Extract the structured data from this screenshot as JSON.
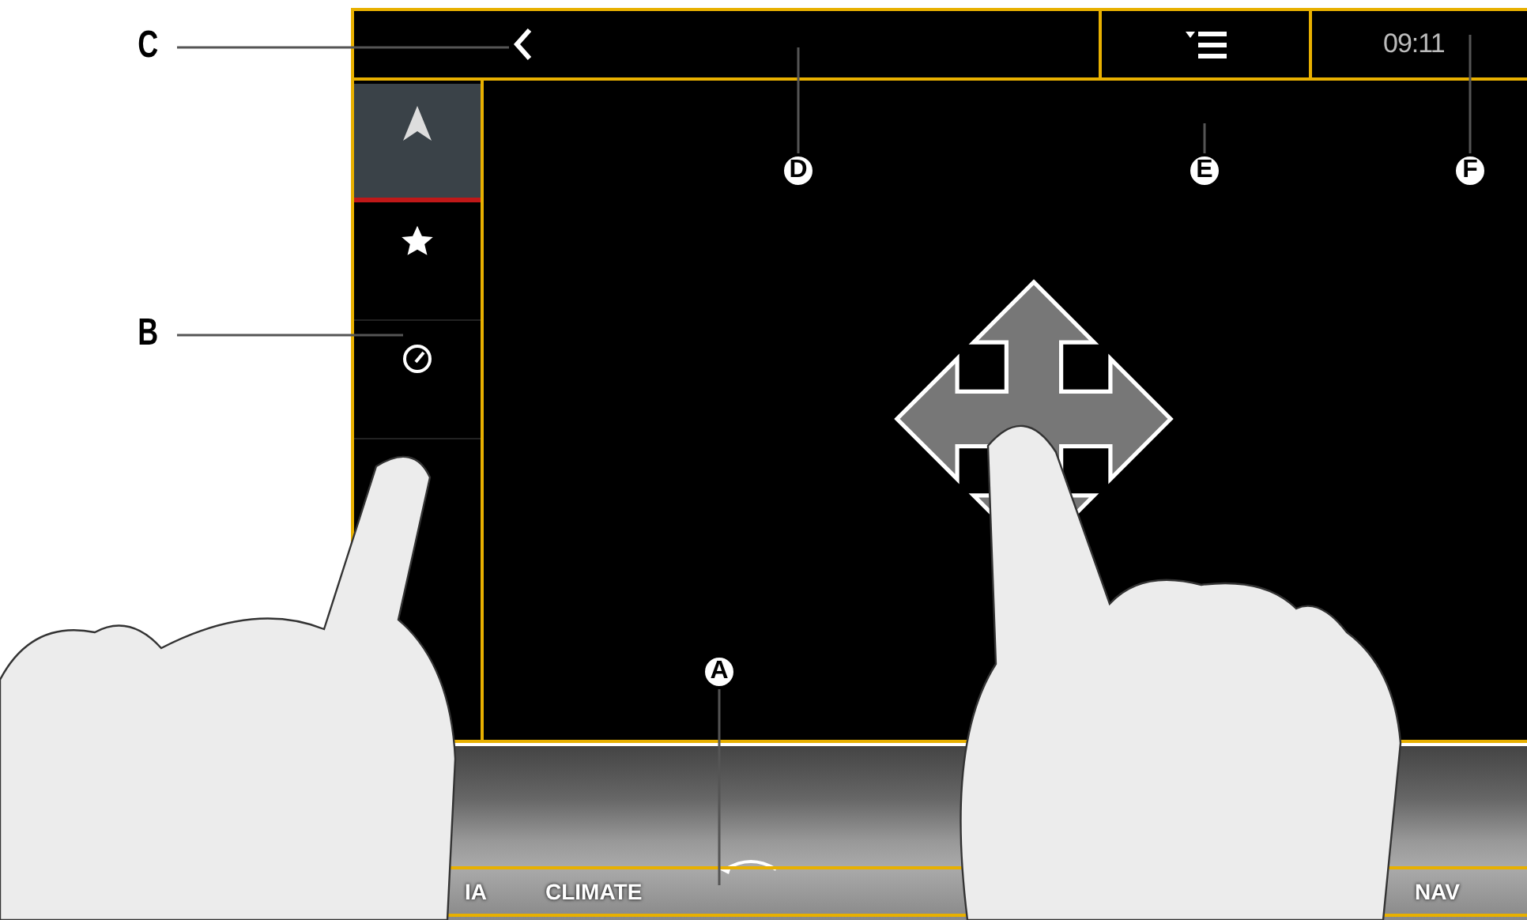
{
  "top_bar": {
    "time": "09:11"
  },
  "sidebar": {
    "items": [
      {
        "kind": "navigation",
        "selected": true
      },
      {
        "kind": "favorites",
        "selected": false
      },
      {
        "kind": "gauge",
        "selected": false
      }
    ]
  },
  "callouts": [
    {
      "label": "C",
      "kind": "plain"
    },
    {
      "label": "B",
      "kind": "plain"
    },
    {
      "label": "D",
      "kind": "circled"
    },
    {
      "label": "E",
      "kind": "circled"
    },
    {
      "label": "F",
      "kind": "circled"
    },
    {
      "label": "A",
      "kind": "circled"
    }
  ],
  "console": {
    "buttons": [
      "IA",
      "CLIMATE",
      "NAV"
    ]
  }
}
